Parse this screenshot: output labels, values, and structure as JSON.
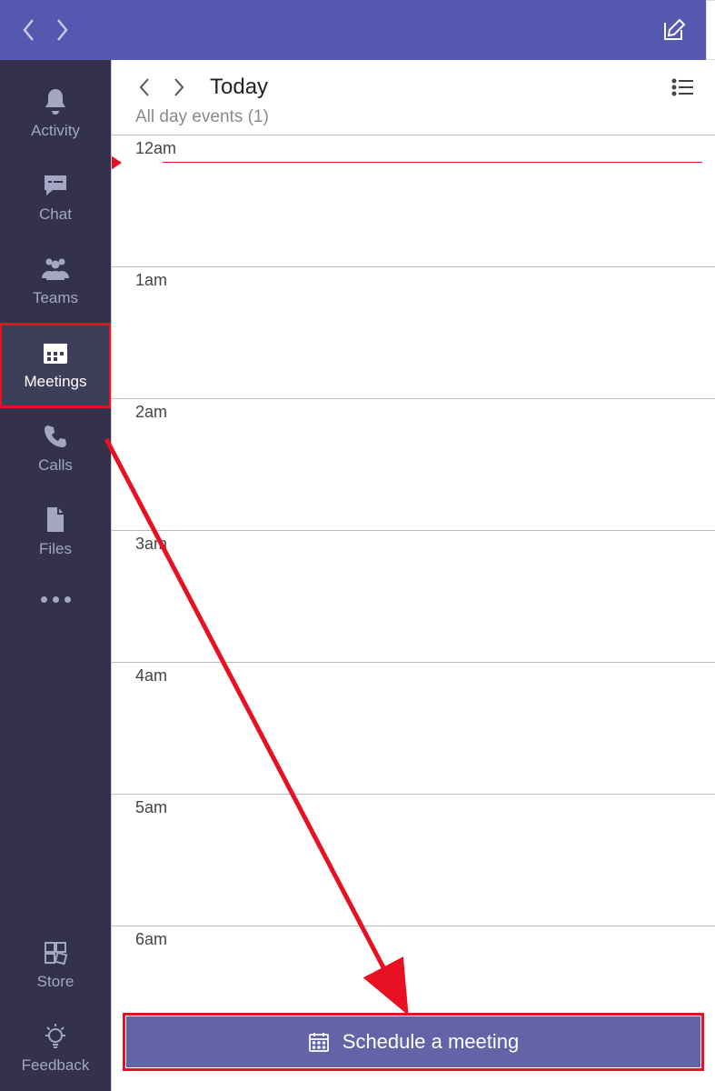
{
  "titlebar": {
    "back_aria": "Back",
    "forward_aria": "Forward",
    "compose_aria": "New"
  },
  "rail": {
    "items": [
      {
        "id": "activity",
        "label": "Activity"
      },
      {
        "id": "chat",
        "label": "Chat"
      },
      {
        "id": "teams",
        "label": "Teams"
      },
      {
        "id": "meetings",
        "label": "Meetings",
        "selected": true
      },
      {
        "id": "calls",
        "label": "Calls"
      },
      {
        "id": "files",
        "label": "Files"
      }
    ],
    "more_aria": "More",
    "bottom": [
      {
        "id": "store",
        "label": "Store"
      },
      {
        "id": "feedback",
        "label": "Feedback"
      }
    ]
  },
  "calendar": {
    "prev_day_aria": "Previous day",
    "next_day_aria": "Next day",
    "title": "Today",
    "list_toggle_aria": "List view",
    "all_day_label": "All day events (1)",
    "hours": [
      "12am",
      "1am",
      "2am",
      "3am",
      "4am",
      "5am",
      "6am"
    ],
    "schedule_button_label": "Schedule a meeting"
  },
  "annotation": {
    "highlight_rail_item": "meetings",
    "arrow_target": "schedule-button"
  }
}
